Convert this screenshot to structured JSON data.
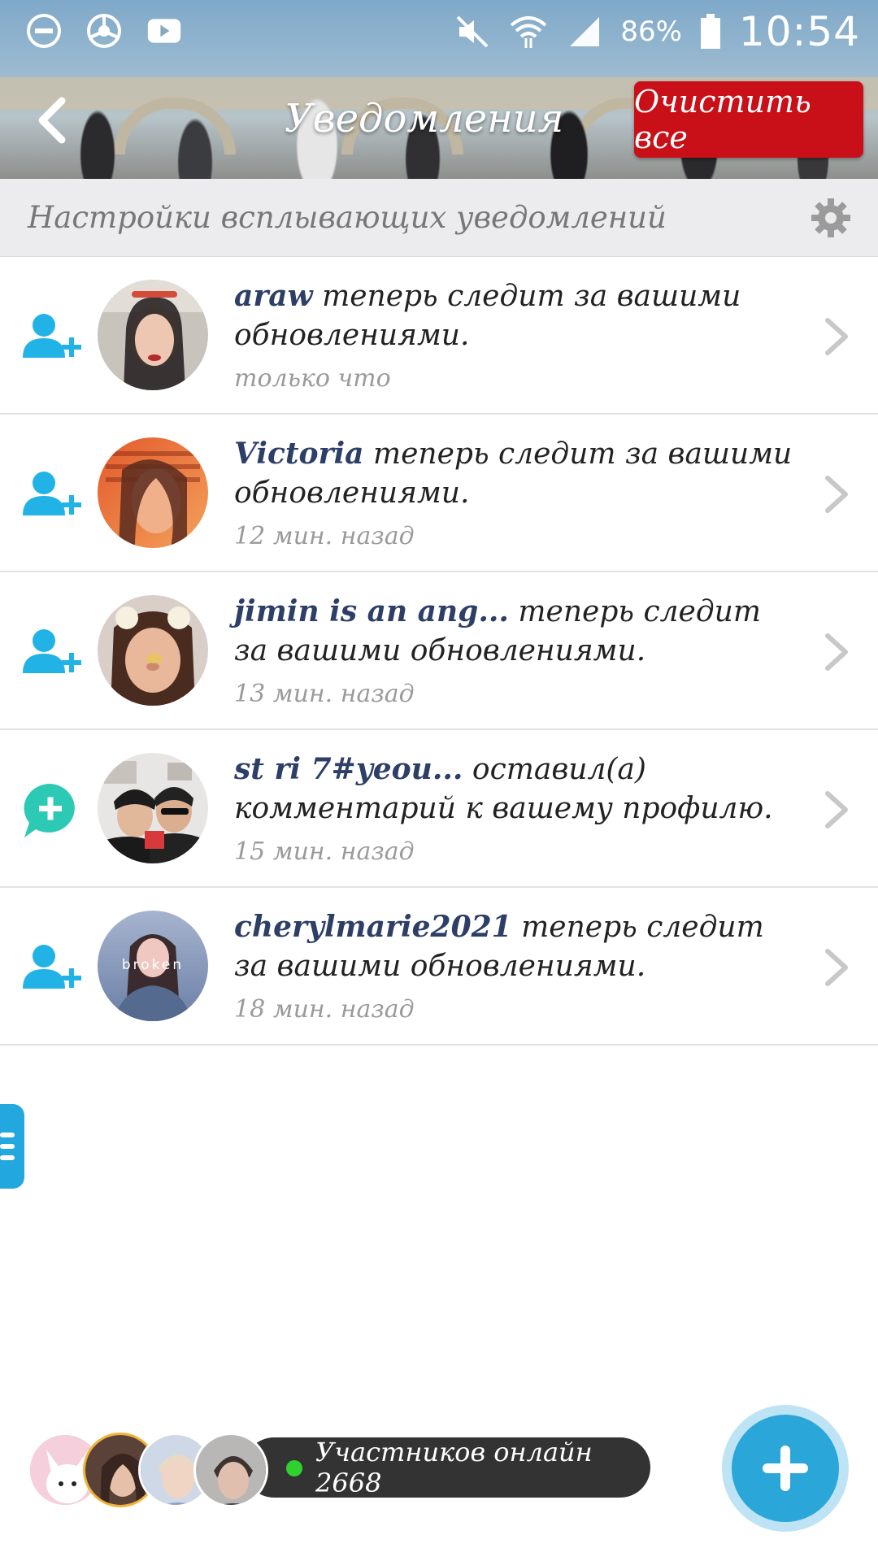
{
  "status_bar": {
    "battery": "86%",
    "time": "10:54",
    "icons": [
      "do-not-disturb-icon",
      "chrome-icon",
      "youtube-icon",
      "mute-icon",
      "wifi-icon",
      "signal-icon",
      "battery-icon"
    ]
  },
  "header": {
    "title": "Уведомления",
    "clear_all": "Очистить все"
  },
  "settings": {
    "label": "Настройки всплывающих уведомлений"
  },
  "notifications": [
    {
      "type": "follow",
      "user": "araw",
      "text": "теперь следит за вашими обновлениями.",
      "time": "только что"
    },
    {
      "type": "follow",
      "user": "Victoria",
      "text": "теперь следит за вашими обновлениями.",
      "time": "12 мин. назад"
    },
    {
      "type": "follow",
      "user": "jimin is an ang...",
      "text": "теперь следит за вашими обновлениями.",
      "time": "13 мин. назад"
    },
    {
      "type": "comment",
      "user": "  st ri 7#yeou...",
      "text": "оставил(а) комментарий к вашему профилю.",
      "time": "15 мин. назад"
    },
    {
      "type": "follow",
      "user": "cherylmarie2021",
      "text": "теперь следит за вашими обновлениями.",
      "time": "18 мин. назад"
    }
  ],
  "avatar_overlay_text": "broken",
  "online": {
    "label": "Участников онлайн 2668"
  },
  "colors": {
    "accent": "#23a7df",
    "clear_button": "#c91018",
    "username": "#2d3e67",
    "follow_icon": "#22b3e6",
    "comment_icon": "#2cc9b5",
    "online_dot": "#2fd12f"
  }
}
